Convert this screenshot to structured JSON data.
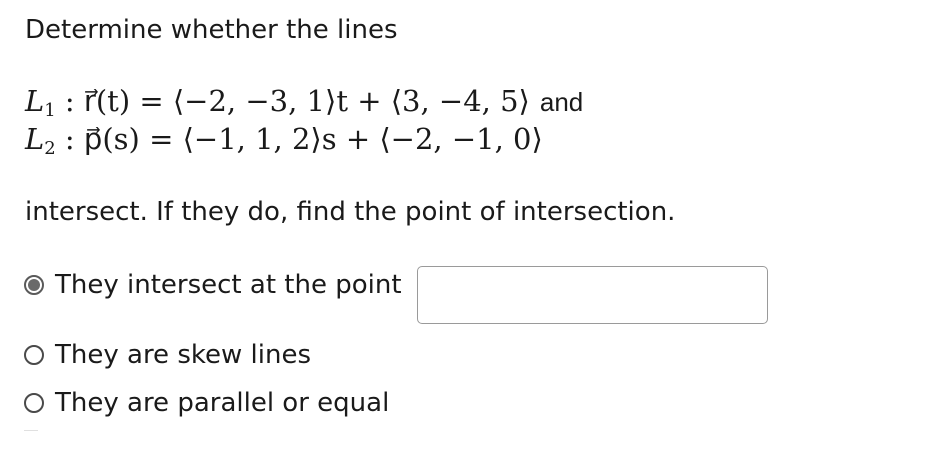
{
  "question": {
    "prompt": "Determine whether the lines",
    "line1": {
      "name": "L",
      "index": "1",
      "equation": " : r⃗(t) = ⟨−2, −3, 1⟩t + ⟨3, −4, 5⟩",
      "conjunction": "and"
    },
    "line2": {
      "name": "L",
      "index": "2",
      "equation": " : p⃗(s) = ⟨−1, 1, 2⟩s + ⟨−2, −1, 0⟩"
    },
    "followup": "intersect. If they do, find the point of intersection."
  },
  "options": [
    {
      "label": "They intersect at the point",
      "selected": true
    },
    {
      "label": "They are skew lines",
      "selected": false
    },
    {
      "label": "They are parallel or equal",
      "selected": false
    }
  ],
  "answer_input": {
    "value": "",
    "placeholder": ""
  }
}
